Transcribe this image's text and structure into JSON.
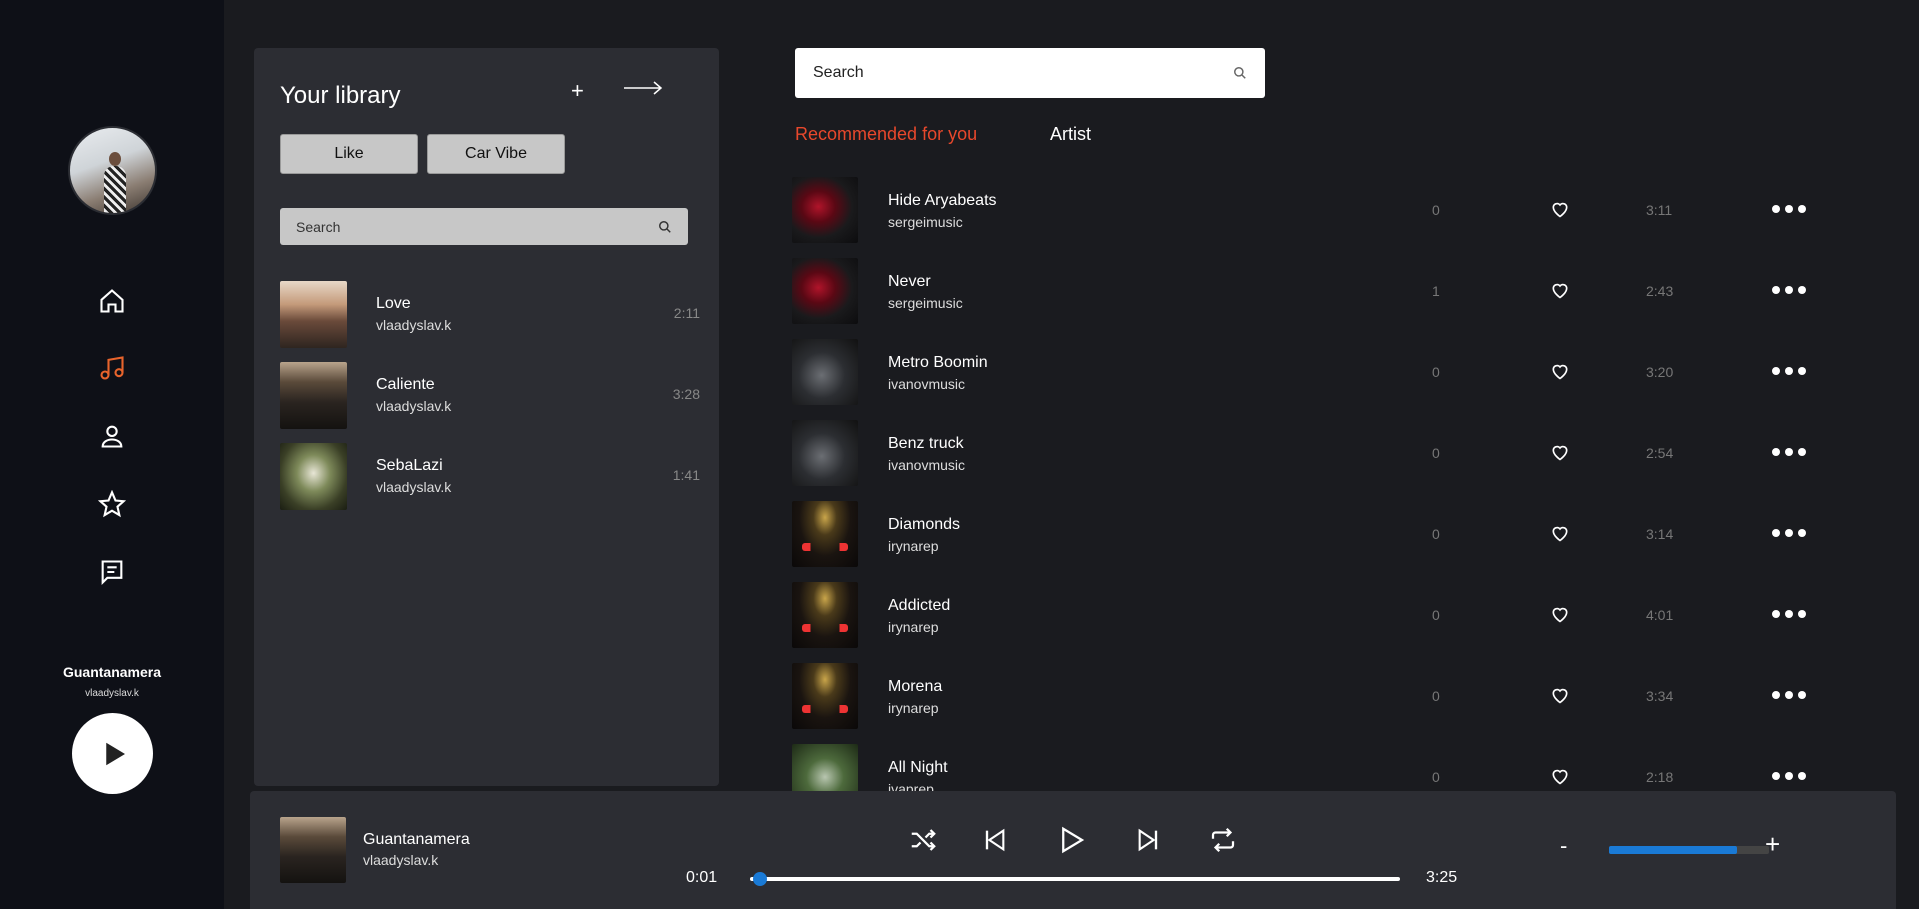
{
  "sidebar": {
    "nav": [
      {
        "name": "home",
        "icon": "home-icon",
        "active": false
      },
      {
        "name": "music",
        "icon": "music-note-icon",
        "active": true
      },
      {
        "name": "profile",
        "icon": "user-icon",
        "active": false
      },
      {
        "name": "favorites",
        "icon": "star-icon",
        "active": false
      },
      {
        "name": "messages",
        "icon": "chat-icon",
        "active": false
      }
    ],
    "now_playing": {
      "title": "Guantanamera",
      "artist": "vlaadyslav.k"
    }
  },
  "library": {
    "title": "Your library",
    "add_label": "+",
    "chips": [
      "Like",
      "Car Vibe"
    ],
    "search_placeholder": "Search",
    "items": [
      {
        "name": "Love",
        "artist": "vlaadyslav.k",
        "duration": "2:11"
      },
      {
        "name": "Caliente",
        "artist": "vlaadyslav.k",
        "duration": "3:28"
      },
      {
        "name": "SebaLazi",
        "artist": "vlaadyslav.k",
        "duration": "1:41"
      }
    ]
  },
  "main": {
    "search_placeholder": "Search",
    "tabs": [
      "Recommended for you",
      "Artist"
    ],
    "tracks": [
      {
        "name": "Hide Aryabeats",
        "artist": "sergeimusic",
        "count": "0",
        "duration": "3:11"
      },
      {
        "name": "Never",
        "artist": "sergeimusic",
        "count": "1",
        "duration": "2:43"
      },
      {
        "name": "Metro Boomin",
        "artist": "ivanovmusic",
        "count": "0",
        "duration": "3:20"
      },
      {
        "name": "Benz truck",
        "artist": "ivanovmusic",
        "count": "0",
        "duration": "2:54"
      },
      {
        "name": "Diamonds",
        "artist": "irynarep",
        "count": "0",
        "duration": "3:14"
      },
      {
        "name": "Addicted",
        "artist": "irynarep",
        "count": "0",
        "duration": "4:01"
      },
      {
        "name": "Morena",
        "artist": "irynarep",
        "count": "0",
        "duration": "3:34"
      },
      {
        "name": "All Night",
        "artist": "ivaprep",
        "count": "0",
        "duration": "2:18"
      }
    ]
  },
  "player": {
    "title": "Guantanamera",
    "artist": "vlaadyslav.k",
    "current_time": "0:01",
    "total_time": "3:25",
    "progress": 0.005,
    "volume": 0.8,
    "volume_minus": "-",
    "volume_plus": "+"
  },
  "colors": {
    "accent": "#e8482c",
    "progress": "#1a7ad6",
    "background": "#1a1b1f",
    "sidebar": "#0e1017",
    "panel": "#2c2d33"
  }
}
